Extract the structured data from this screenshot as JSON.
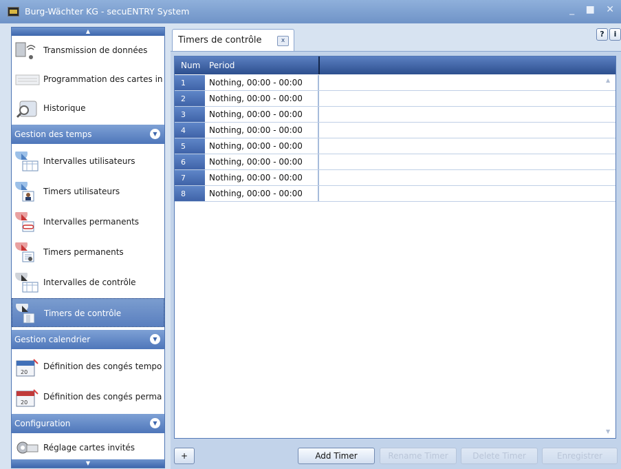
{
  "window": {
    "title": "Burg-Wächter KG - secuENTRY System",
    "controls": "_ ■ ✕"
  },
  "sidebar": {
    "items_top": [
      {
        "label": "Transmission de données",
        "icon": "data-transmission-icon"
      },
      {
        "label": "Programmation des cartes in",
        "icon": "card-programming-icon"
      },
      {
        "label": "Historique",
        "icon": "history-magnifier-icon"
      }
    ],
    "groups": [
      {
        "label": "Gestion des temps",
        "items": [
          {
            "label": "Intervalles utilisateurs",
            "icon": "user-interval-icon"
          },
          {
            "label": "Timers utilisateurs",
            "icon": "user-timer-icon"
          },
          {
            "label": "Intervalles permanents",
            "icon": "permanent-interval-icon"
          },
          {
            "label": "Timers permanents",
            "icon": "permanent-timer-icon"
          },
          {
            "label": "Intervalles de contrôle",
            "icon": "control-interval-icon"
          },
          {
            "label": "Timers de contrôle",
            "icon": "control-timer-icon",
            "selected": true
          }
        ]
      },
      {
        "label": "Gestion calendrier",
        "items": [
          {
            "label": "Définition des congés tempo",
            "icon": "calendar-temporary-icon"
          },
          {
            "label": "Définition des congés perma",
            "icon": "calendar-permanent-icon"
          }
        ]
      },
      {
        "label": "Configuration",
        "items": [
          {
            "label": "Réglage cartes invités",
            "icon": "guest-card-settings-icon"
          }
        ]
      }
    ]
  },
  "tab": {
    "label": "Timers de contrôle",
    "close": "x",
    "help": "?",
    "info": "i"
  },
  "grid": {
    "columns": [
      "Num",
      "Period"
    ],
    "rows": [
      {
        "num": "1",
        "period": "Nothing, 00:00 - 00:00"
      },
      {
        "num": "2",
        "period": "Nothing, 00:00 - 00:00"
      },
      {
        "num": "3",
        "period": "Nothing, 00:00 - 00:00"
      },
      {
        "num": "4",
        "period": "Nothing, 00:00 - 00:00"
      },
      {
        "num": "5",
        "period": "Nothing, 00:00 - 00:00"
      },
      {
        "num": "6",
        "period": "Nothing, 00:00 - 00:00"
      },
      {
        "num": "7",
        "period": "Nothing, 00:00 - 00:00"
      },
      {
        "num": "8",
        "period": "Nothing, 00:00 - 00:00"
      }
    ]
  },
  "buttons": {
    "plus": "+",
    "add": "Add Timer",
    "rename": "Rename Timer",
    "delete": "Delete Timer",
    "save": "Enregistrer"
  }
}
